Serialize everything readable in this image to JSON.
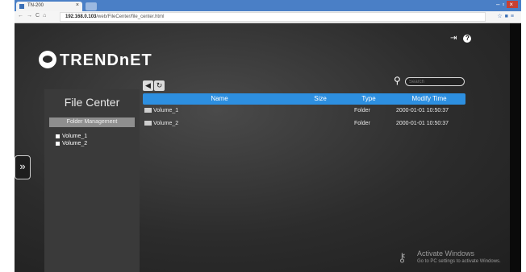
{
  "browser": {
    "tab_title": "TN-200",
    "url_host": "192.168.0.103",
    "url_path": "/web/FileCenter/file_center.html"
  },
  "app": {
    "logo_text": "TRENDnET",
    "panel_title": "File Center",
    "section_label": "Folder Management",
    "tree": [
      {
        "label": "Volume_1"
      },
      {
        "label": "Volume_2"
      }
    ],
    "search_placeholder": "Search",
    "table": {
      "columns": [
        "Name",
        "Size",
        "Type",
        "Modify Time"
      ],
      "rows": [
        {
          "name": "Volume_1",
          "size": "",
          "type": "Folder",
          "modified": "2000-01-01 10:50:37"
        },
        {
          "name": "Volume_2",
          "size": "",
          "type": "Folder",
          "modified": "2000-01-01 10:50:37"
        }
      ]
    }
  },
  "watermark": {
    "line1": "Activate Windows",
    "line2": "Go to PC settings to activate Windows."
  },
  "colors": {
    "accent": "#2d8fe0",
    "background": "#2c2c2c",
    "panel": "#3a3a3a"
  }
}
